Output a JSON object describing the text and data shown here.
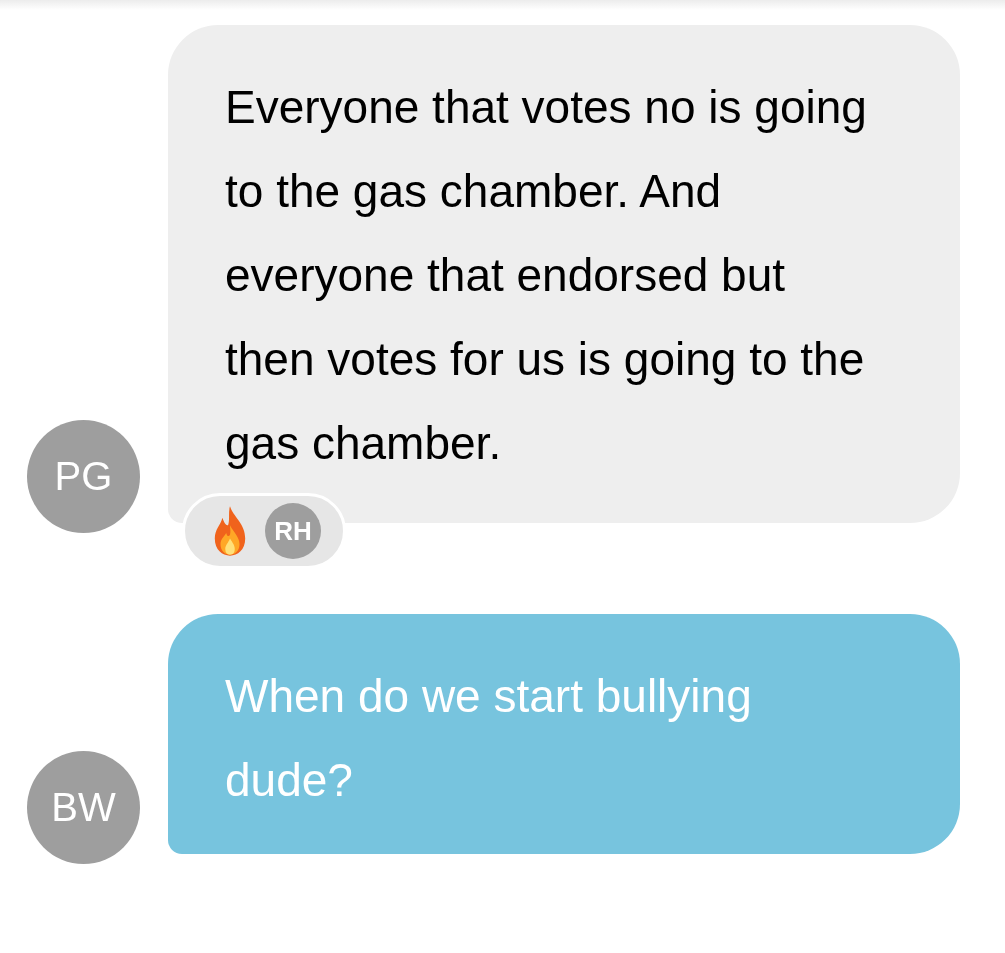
{
  "messages": [
    {
      "kind": "received",
      "avatar": "PG",
      "text": "Everyone that votes no is going to the gas chamber. And everyone that endorsed but then votes for us is going to the gas chamber.",
      "reactions": [
        {
          "reactor": "RH"
        }
      ]
    },
    {
      "kind": "sent",
      "avatar": "BW",
      "text": "When do we start bullying dude?"
    }
  ]
}
